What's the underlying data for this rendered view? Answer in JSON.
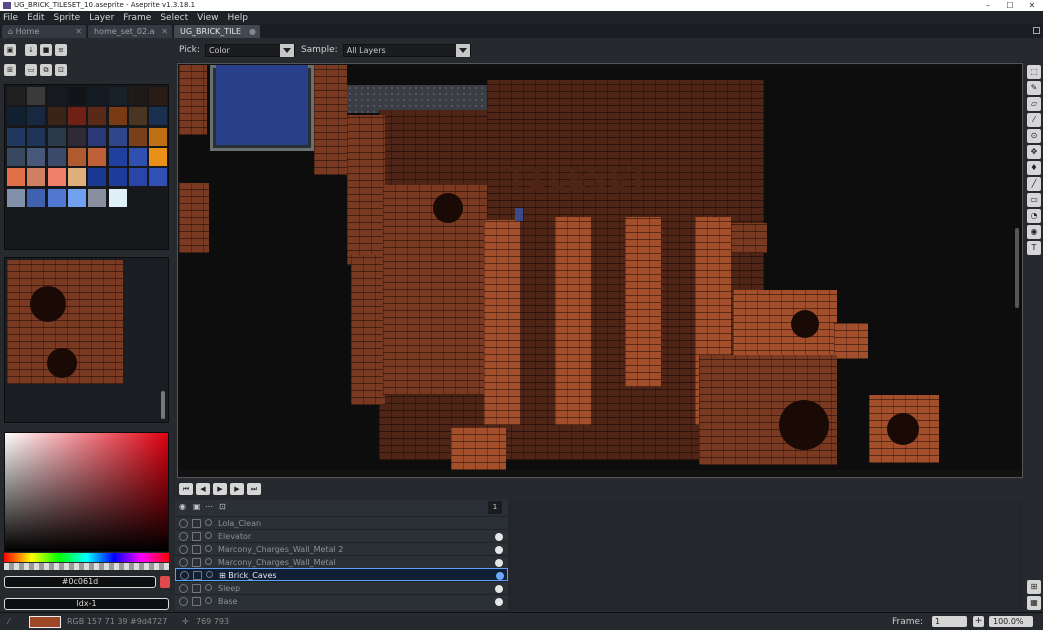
{
  "window": {
    "title": "UG_BRICK_TILESET_10.aseprite - Aseprite v1.3.18.1",
    "minimize": "–",
    "maximize": "☐",
    "close": "✕"
  },
  "menu": [
    "File",
    "Edit",
    "Sprite",
    "Layer",
    "Frame",
    "Select",
    "View",
    "Help"
  ],
  "tabs": [
    {
      "label": "Home"
    },
    {
      "label": "home_set_02.a"
    },
    {
      "label": "UG_BRICK_TILE"
    }
  ],
  "toolopts": {
    "pick_label": "Pick:",
    "pick_value": "Color",
    "sample_label": "Sample:",
    "sample_value": "All Layers"
  },
  "palette": {
    "colors": [
      "#202020",
      "#3a3a3a",
      "#181820",
      "#101418",
      "#131a22",
      "#18202a",
      "#1f1a18",
      "#2a1c14",
      "#102030",
      "#182840",
      "#3a2418",
      "#702014",
      "#5a2a18",
      "#7a3a14",
      "#4a3422",
      "#1a3050",
      "#203860",
      "#203458",
      "#2a3a48",
      "#302a38",
      "#2a3878",
      "#30468a",
      "#7a3e1a",
      "#c07014",
      "#38485e",
      "#48587a",
      "#3a4a68",
      "#b05a30",
      "#c06038",
      "#2040a0",
      "#3050b0",
      "#e89018",
      "#e07048",
      "#d08060",
      "#f0806a",
      "#e0b07a",
      "#1a3890",
      "#203c9a",
      "#2a44a8",
      "#3050b4",
      "#8090a8",
      "#4060b0",
      "#5078d0",
      "#70a0f0",
      "#8890a0",
      "#e0f0f8"
    ]
  },
  "canvas": {
    "title_text": "TILESET"
  },
  "color_fields": {
    "hex": "#0c061d",
    "index": "Idx-1"
  },
  "layers": [
    {
      "name": "Lola_Clean",
      "selected": false,
      "has_dot": false
    },
    {
      "name": "Elevator",
      "selected": false,
      "has_dot": true
    },
    {
      "name": "Marcony_Charges_Wall_Metal 2",
      "selected": false,
      "has_dot": true
    },
    {
      "name": "Marcony_Charges_Wall_Metal",
      "selected": false,
      "has_dot": true
    },
    {
      "name": "⊞ Brick_Caves",
      "selected": true,
      "has_dot": true
    },
    {
      "name": "Sleep",
      "selected": false,
      "has_dot": true
    },
    {
      "name": "Base",
      "selected": false,
      "has_dot": true
    }
  ],
  "timeline": {
    "frame_header": "1"
  },
  "status": {
    "color_text": "RGB 157 71 39 #9d4727",
    "coords": "769 793",
    "frame_label": "Frame:",
    "frame_value": "1",
    "plus": "+",
    "zoom": "100.0%",
    "fg_color": "#9d4727"
  }
}
